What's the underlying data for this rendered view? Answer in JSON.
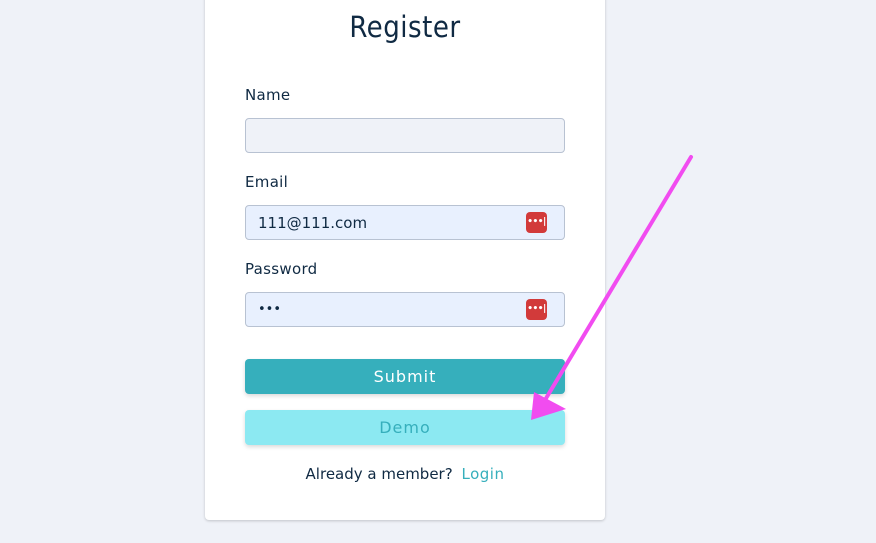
{
  "form": {
    "title": "Register",
    "name_label": "Name",
    "name_value": "",
    "email_label": "Email",
    "email_value": "111@111.com",
    "password_label": "Password",
    "password_value": "•••",
    "submit_label": "Submit",
    "demo_label": "Demo",
    "member_prompt": "Already a member?",
    "login_label": "Login"
  },
  "icons": {
    "password_manager": "password-manager-icon"
  },
  "colors": {
    "background": "#eff2f8",
    "primary": "#36afbc",
    "demo_button": "#8ce9f2",
    "annotation_arrow": "#f14cf0",
    "password_icon": "#d23a3a"
  }
}
